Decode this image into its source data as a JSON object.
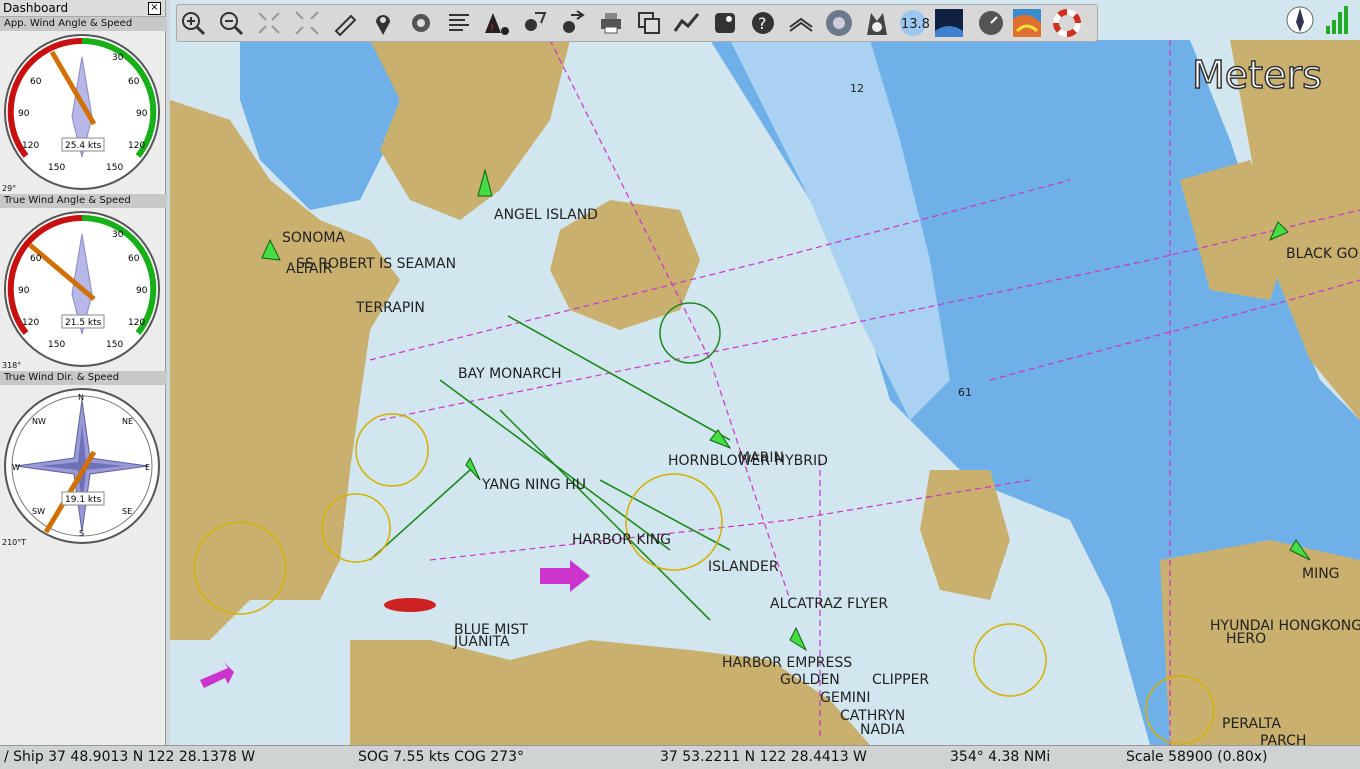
{
  "dashboard": {
    "title": "Dashboard",
    "close": "×",
    "instruments": [
      {
        "title": "App. Wind Angle & Speed",
        "speed": "25.4 kts",
        "angle": "29°",
        "ticks": [
          "30",
          "60",
          "90",
          "120",
          "150",
          "30",
          "60",
          "90",
          "120",
          "150"
        ]
      },
      {
        "title": "True Wind Angle & Speed",
        "speed": "21.5 kts",
        "angle": "318°",
        "ticks": [
          "30",
          "60",
          "90",
          "120",
          "150",
          "30",
          "60",
          "90",
          "120",
          "150"
        ]
      },
      {
        "title": "True Wind Dir. & Speed",
        "speed": "19.1 kts",
        "angle": "210°T",
        "ticks": [
          "N",
          "NE",
          "E",
          "SE",
          "S",
          "SW",
          "W",
          "NW"
        ]
      }
    ]
  },
  "toolbar": {
    "icons": [
      "zoom-in-icon",
      "zoom-out-icon",
      "shrink-icon",
      "expand-icon",
      "route-icon",
      "mark-icon",
      "settings-icon",
      "text-icon",
      "ais-warning-icon",
      "tide-icon",
      "current-icon",
      "print-icon",
      "copy-icon",
      "track-icon",
      "grib-icon",
      "help-icon",
      "layers-icon",
      "wolf-icon",
      "husky-icon",
      "moon-icon",
      "earth-icon",
      "gauge-icon",
      "weather-icon",
      "lifebuoy-icon"
    ],
    "number": "13.8"
  },
  "chart": {
    "depth_units": "Meters",
    "places": [
      "ANGEL ISLAND"
    ],
    "vessels": [
      "SONOMA",
      "ALTAIR",
      "SS ROBERT IS SEAMAN",
      "TERRAPIN",
      "BAY MONARCH",
      "HORNBLOWER HYBRID",
      "MARIN",
      "YANG NING HU",
      "HARBOR KING",
      "ISLANDER",
      "ALCATRAZ FLYER",
      "BLUE MIST",
      "JUANITA",
      "HARBOR EMPRESS",
      "GOLDEN",
      "CLIPPER",
      "GEMINI",
      "CATHRYN",
      "NADIA",
      "BLACK GO",
      "HYUNDAI HONGKONG",
      "HERO",
      "PERALTA",
      "PARCH",
      "MING"
    ],
    "soundings": [
      "12",
      "61"
    ]
  },
  "status": {
    "ship": "/ Ship 37 48.9013 N   122 28.1378 W",
    "sog": "SOG 7.55 kts  COG 273°",
    "cursor": "37 53.2211 N   122 28.4413 W",
    "bearing": "354°  4.38 NMi",
    "scale": "Scale 58900 (0.80x)"
  },
  "colors": {
    "land": "#c9b06e",
    "shallow": "#74b3e8",
    "deep": "#d2e6ef",
    "route": "#cc33cc",
    "ais": "#22aa22"
  }
}
